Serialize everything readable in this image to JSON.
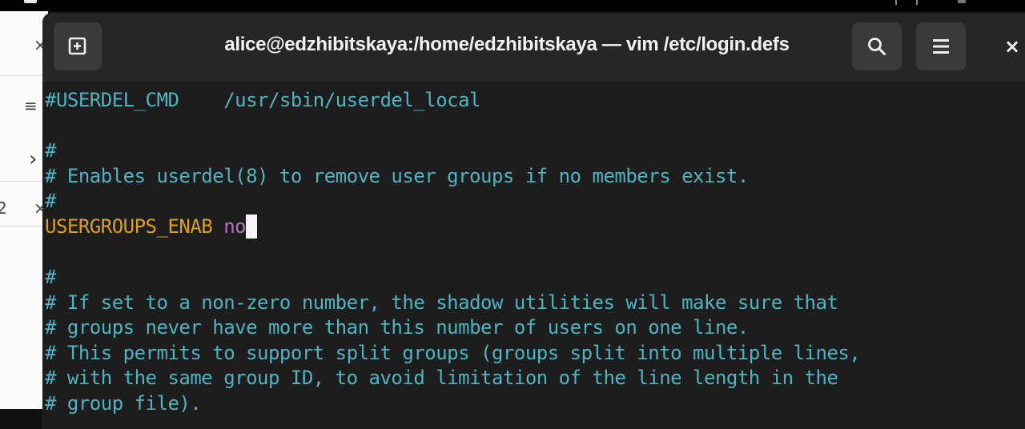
{
  "window": {
    "title": "alice@edzhibitskaya:/home/edzhibitskaya — vim /etc/login.defs",
    "close_glyph": "×"
  },
  "icons": {
    "new_tab": "new-tab-icon",
    "search": "search-icon",
    "menu": "hamburger-menu-icon",
    "close": "close-icon"
  },
  "colors": {
    "comment": "#4fb3c1",
    "keyword": "#d8a020",
    "value": "#b86ec4",
    "cursor": "#f4f4f4",
    "terminal_bg": "#1d1d1d",
    "header_bg": "#262626"
  },
  "background_app": {
    "glyphs": [
      "×",
      "≡",
      "›",
      "2",
      "×"
    ]
  },
  "buffer": {
    "line1": "#USERDEL_CMD    /usr/sbin/userdel_local",
    "line2": "",
    "line3": "#",
    "line4": "# Enables userdel(8) to remove user groups if no members exist.",
    "line5": "#",
    "line6_key": "USERGROUPS_ENAB",
    "line6_value": "no",
    "line7": "",
    "line8": "#",
    "line9": "# If set to a non-zero number, the shadow utilities will make sure that",
    "line10": "# groups never have more than this number of users on one line.",
    "line11": "# This permits to support split groups (groups split into multiple lines,",
    "line12": "# with the same group ID, to avoid limitation of the line length in the",
    "line13": "# group file)."
  }
}
